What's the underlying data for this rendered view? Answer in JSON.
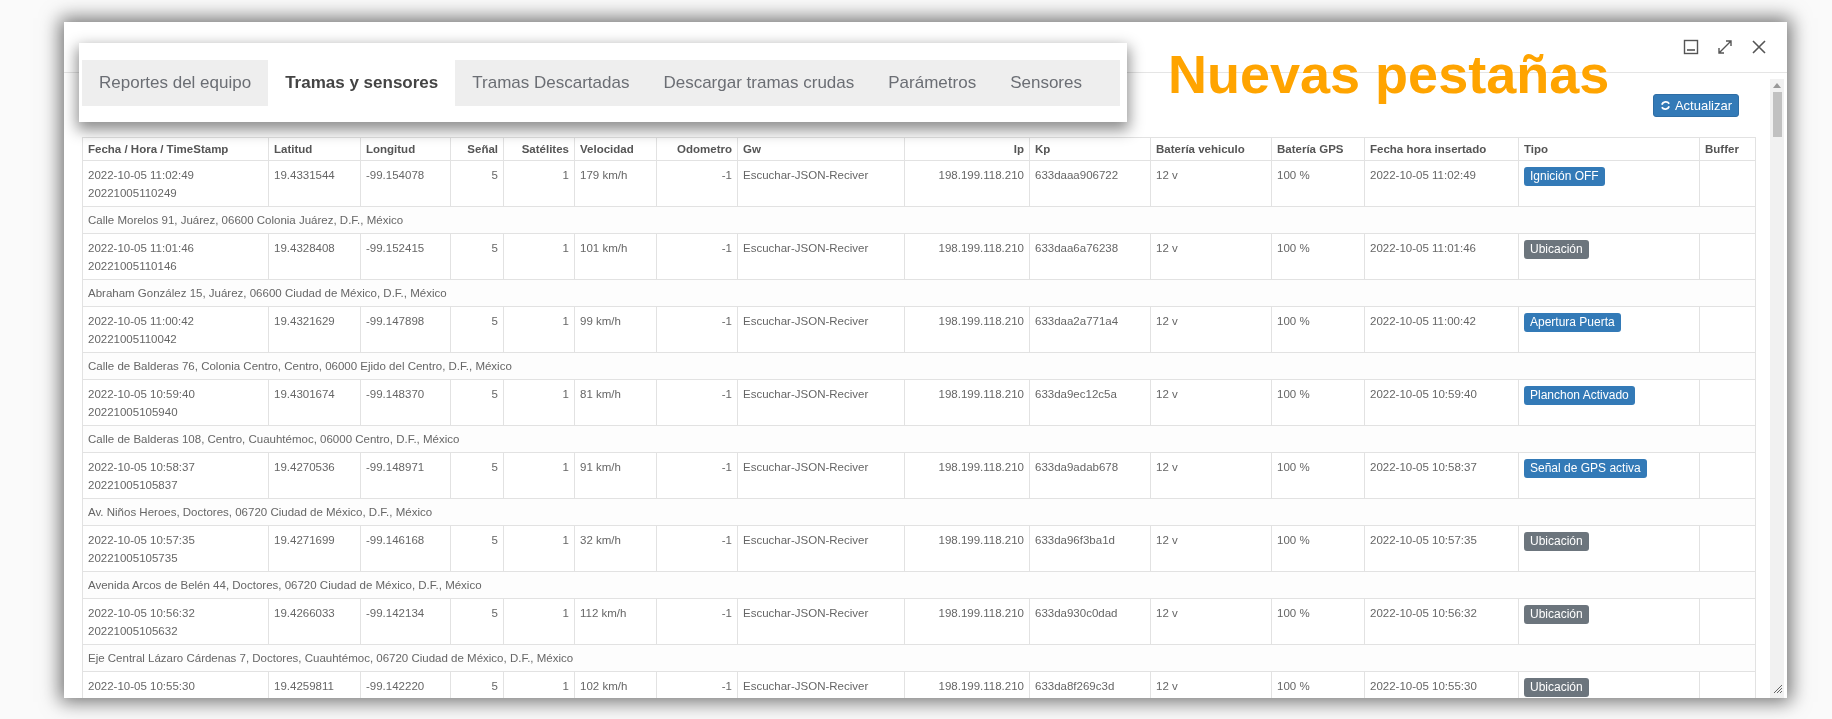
{
  "tabs": [
    {
      "label": "Reportes del equipo",
      "selected": false
    },
    {
      "label": "Tramas y sensores",
      "selected": true
    },
    {
      "label": "Tramas Descartadas",
      "selected": false
    },
    {
      "label": "Descargar tramas crudas",
      "selected": false
    },
    {
      "label": "Parámetros",
      "selected": false
    },
    {
      "label": "Sensores",
      "selected": false
    }
  ],
  "annotation": "Nuevas pestañas",
  "refresh_button": "Actualizar",
  "table": {
    "columns": [
      "Fecha / Hora / TimeStamp",
      "Latitud",
      "Longitud",
      "Señal",
      "Satélites",
      "Velocidad",
      "Odometro",
      "Gw",
      "Ip",
      "Kp",
      "Batería vehiculo",
      "Batería GPS",
      "Fecha hora insertado",
      "Tipo",
      "Buffer"
    ],
    "rows": [
      {
        "timestamp": "20221005110249",
        "cells": [
          "2022-10-05 11:02:49",
          "19.4331544",
          "-99.154078",
          "5",
          "1",
          "179 km/h",
          "-1",
          "Escuchar-JSON-Reciver",
          "198.199.118.210",
          "633daaa906722",
          "12 v",
          "100 %",
          "2022-10-05 11:02:49"
        ],
        "tipo": {
          "label": "Ignición OFF",
          "color": "#337ab7"
        },
        "address": "Calle Morelos 91, Juárez, 06600 Colonia Juárez, D.F., México"
      },
      {
        "timestamp": "20221005110146",
        "cells": [
          "2022-10-05 11:01:46",
          "19.4328408",
          "-99.152415",
          "5",
          "1",
          "101 km/h",
          "-1",
          "Escuchar-JSON-Reciver",
          "198.199.118.210",
          "633daa6a76238",
          "12 v",
          "100 %",
          "2022-10-05 11:01:46"
        ],
        "tipo": {
          "label": "Ubicación",
          "color": "#6c757d"
        },
        "address": "Abraham González 15, Juárez, 06600 Ciudad de México, D.F., México"
      },
      {
        "timestamp": "20221005110042",
        "cells": [
          "2022-10-05 11:00:42",
          "19.4321629",
          "-99.147898",
          "5",
          "1",
          "99 km/h",
          "-1",
          "Escuchar-JSON-Reciver",
          "198.199.118.210",
          "633daa2a771a4",
          "12 v",
          "100 %",
          "2022-10-05 11:00:42"
        ],
        "tipo": {
          "label": "Apertura Puerta",
          "color": "#337ab7"
        },
        "address": "Calle de Balderas 76, Colonia Centro, Centro, 06000 Ejido del Centro, D.F., México"
      },
      {
        "timestamp": "20221005105940",
        "cells": [
          "2022-10-05 10:59:40",
          "19.4301674",
          "-99.148370",
          "5",
          "1",
          "81 km/h",
          "-1",
          "Escuchar-JSON-Reciver",
          "198.199.118.210",
          "633da9ec12c5a",
          "12 v",
          "100 %",
          "2022-10-05 10:59:40"
        ],
        "tipo": {
          "label": "Planchon Activado",
          "color": "#337ab7"
        },
        "address": "Calle de Balderas 108, Centro, Cuauhtémoc, 06000 Centro, D.F., México"
      },
      {
        "timestamp": "20221005105837",
        "cells": [
          "2022-10-05 10:58:37",
          "19.4270536",
          "-99.148971",
          "5",
          "1",
          "91 km/h",
          "-1",
          "Escuchar-JSON-Reciver",
          "198.199.118.210",
          "633da9adab678",
          "12 v",
          "100 %",
          "2022-10-05 10:58:37"
        ],
        "tipo": {
          "label": "Señal de GPS activa",
          "color": "#337ab7"
        },
        "address": "Av. Niños Heroes, Doctores, 06720 Ciudad de México, D.F., México"
      },
      {
        "timestamp": "20221005105735",
        "cells": [
          "2022-10-05 10:57:35",
          "19.4271699",
          "-99.146168",
          "5",
          "1",
          "32 km/h",
          "-1",
          "Escuchar-JSON-Reciver",
          "198.199.118.210",
          "633da96f3ba1d",
          "12 v",
          "100 %",
          "2022-10-05 10:57:35"
        ],
        "tipo": {
          "label": "Ubicación",
          "color": "#6c757d"
        },
        "address": "Avenida Arcos de Belén 44, Doctores, 06720 Ciudad de México, D.F., México"
      },
      {
        "timestamp": "20221005105632",
        "cells": [
          "2022-10-05 10:56:32",
          "19.4266033",
          "-99.142134",
          "5",
          "1",
          "112 km/h",
          "-1",
          "Escuchar-JSON-Reciver",
          "198.199.118.210",
          "633da930c0dad",
          "12 v",
          "100 %",
          "2022-10-05 10:56:32"
        ],
        "tipo": {
          "label": "Ubicación",
          "color": "#6c757d"
        },
        "address": "Eje Central Lázaro Cárdenas 7, Doctores, Cuauhtémoc, 06720 Ciudad de México, D.F., México"
      },
      {
        "cells": [
          "2022-10-05 10:55:30",
          "19.4259811",
          "-99.142220",
          "5",
          "1",
          "102 km/h",
          "-1",
          "Escuchar-JSON-Reciver",
          "198.199.118.210",
          "633da8f269c3d",
          "12 v",
          "100 %",
          "2022-10-05 10:55:30"
        ],
        "tipo": {
          "label": "Ubicación",
          "color": "#6c757d"
        }
      }
    ]
  }
}
